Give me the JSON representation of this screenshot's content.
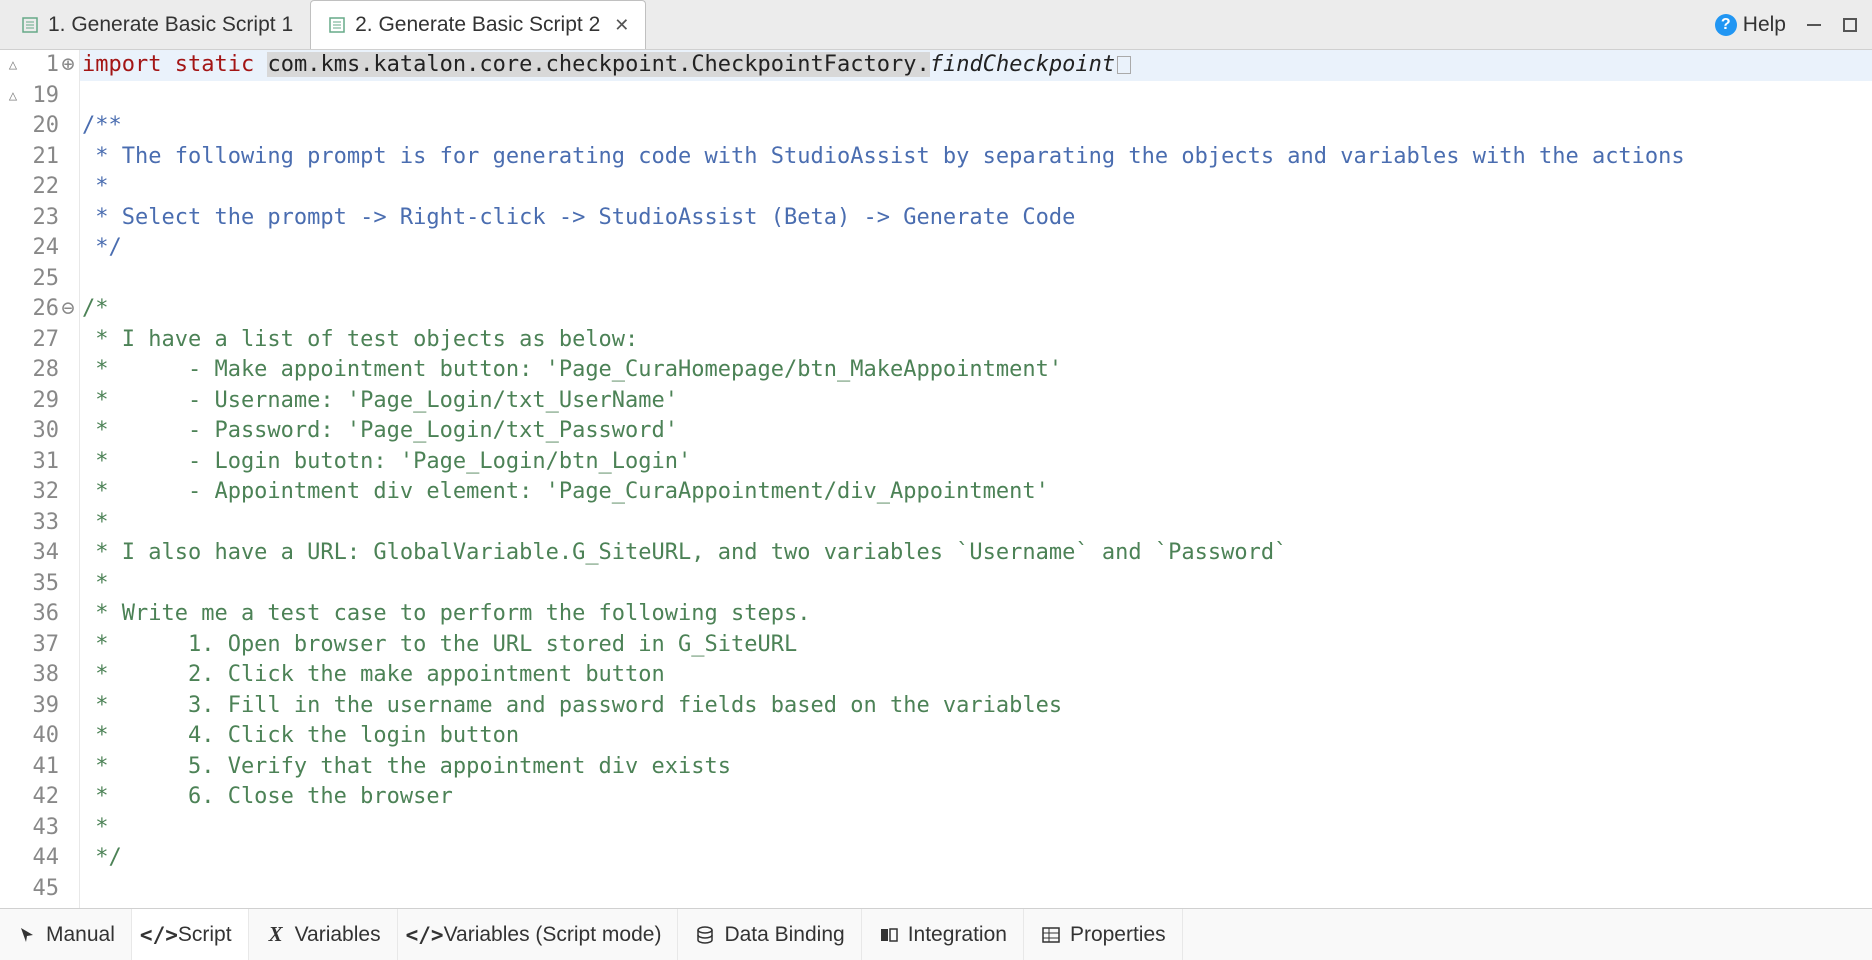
{
  "tabs": [
    {
      "label": "1. Generate Basic Script 1",
      "active": false
    },
    {
      "label": "2. Generate Basic Script 2",
      "active": true
    }
  ],
  "help_label": "Help",
  "code": {
    "line1": {
      "kw1": "import",
      "kw2": "static",
      "gray": "com.kms.katalon.core.checkpoint.CheckpointFactory.",
      "tail": "findCheckpoint"
    },
    "lines": [
      {
        "n": 19,
        "type": "blank",
        "t": ""
      },
      {
        "n": 20,
        "type": "doc",
        "t": "/**"
      },
      {
        "n": 21,
        "type": "doc",
        "t": " * The following prompt is for generating code with StudioAssist by separating the objects and variables with the actions"
      },
      {
        "n": 22,
        "type": "doc",
        "t": " *"
      },
      {
        "n": 23,
        "type": "doc",
        "t": " * Select the prompt -> Right-click -> StudioAssist (Beta) -> Generate Code"
      },
      {
        "n": 24,
        "type": "doc",
        "t": " */"
      },
      {
        "n": 25,
        "type": "blank",
        "t": ""
      },
      {
        "n": 26,
        "type": "cm",
        "t": "/*"
      },
      {
        "n": 27,
        "type": "cm",
        "t": " * I have a list of test objects as below:"
      },
      {
        "n": 28,
        "type": "cm",
        "t": " *      - Make appointment button: 'Page_CuraHomepage/btn_MakeAppointment'"
      },
      {
        "n": 29,
        "type": "cm",
        "t": " *      - Username: 'Page_Login/txt_UserName'"
      },
      {
        "n": 30,
        "type": "cm",
        "t": " *      - Password: 'Page_Login/txt_Password'"
      },
      {
        "n": 31,
        "type": "cm",
        "t": " *      - Login butotn: 'Page_Login/btn_Login'"
      },
      {
        "n": 32,
        "type": "cm",
        "t": " *      - Appointment div element: 'Page_CuraAppointment/div_Appointment'"
      },
      {
        "n": 33,
        "type": "cm",
        "t": " *"
      },
      {
        "n": 34,
        "type": "cm",
        "t": " * I also have a URL: GlobalVariable.G_SiteURL, and two variables `Username` and `Password`"
      },
      {
        "n": 35,
        "type": "cm",
        "t": " *"
      },
      {
        "n": 36,
        "type": "cm",
        "t": " * Write me a test case to perform the following steps."
      },
      {
        "n": 37,
        "type": "cm",
        "t": " *      1. Open browser to the URL stored in G_SiteURL"
      },
      {
        "n": 38,
        "type": "cm",
        "t": " *      2. Click the make appointment button"
      },
      {
        "n": 39,
        "type": "cm",
        "t": " *      3. Fill in the username and password fields based on the variables"
      },
      {
        "n": 40,
        "type": "cm",
        "t": " *      4. Click the login button"
      },
      {
        "n": 41,
        "type": "cm",
        "t": " *      5. Verify that the appointment div exists"
      },
      {
        "n": 42,
        "type": "cm",
        "t": " *      6. Close the browser"
      },
      {
        "n": 43,
        "type": "cm",
        "t": " *"
      },
      {
        "n": 44,
        "type": "cm",
        "t": " */"
      },
      {
        "n": 45,
        "type": "blank",
        "t": ""
      }
    ]
  },
  "bottom_tabs": [
    {
      "label": "Manual",
      "icon": "cursor"
    },
    {
      "label": "Script",
      "icon": "code",
      "active": true
    },
    {
      "label": "Variables",
      "icon": "x"
    },
    {
      "label": "Variables (Script mode)",
      "icon": "code"
    },
    {
      "label": "Data Binding",
      "icon": "db"
    },
    {
      "label": "Integration",
      "icon": "int"
    },
    {
      "label": "Properties",
      "icon": "grid"
    }
  ]
}
